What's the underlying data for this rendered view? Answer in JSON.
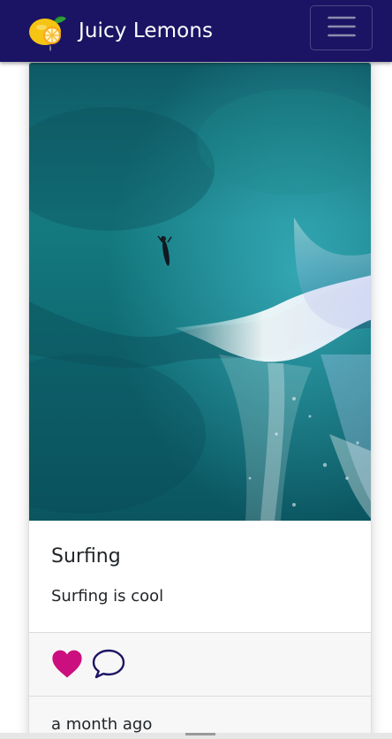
{
  "navbar": {
    "brand_name": "Juicy Lemons",
    "logo_icon": "lemon-logo-icon",
    "menu_icon": "hamburger-menu-icon",
    "background": "#1b1464"
  },
  "post": {
    "title": "Surfing",
    "description": "Surfing is cool",
    "image_icon": "ocean-surfer-photo",
    "liked": true,
    "like_icon": "heart-icon",
    "like_color": "#cc0f7e",
    "comment_icon": "comment-bubble-icon",
    "comment_color": "#1b1464",
    "timestamp": "a month ago"
  }
}
